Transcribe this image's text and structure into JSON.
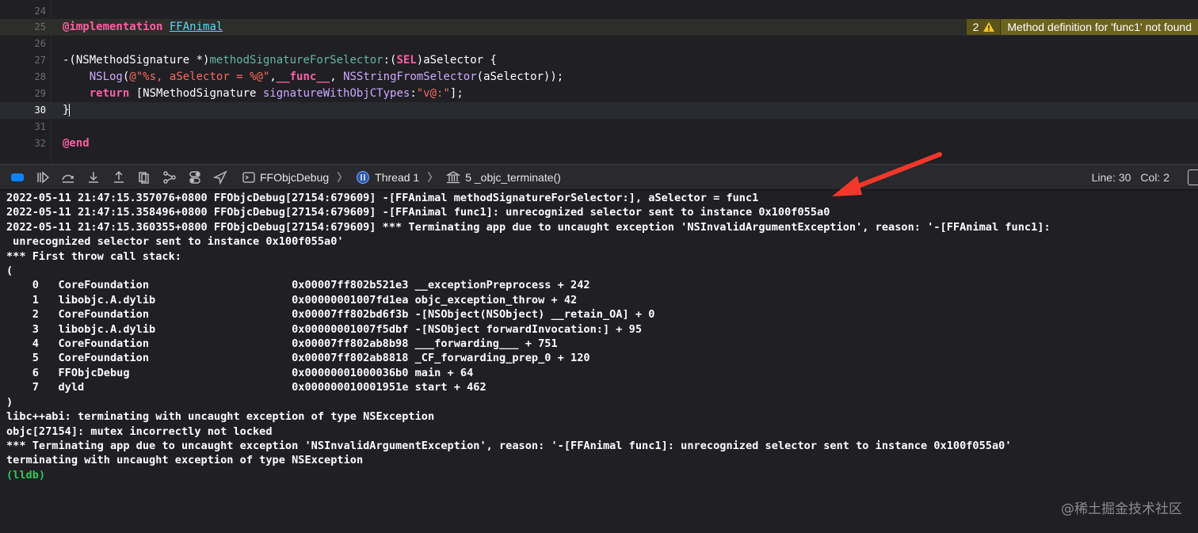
{
  "editor": {
    "lines": [
      {
        "num": "24",
        "segments": []
      },
      {
        "num": "25",
        "segments": [
          {
            "t": "@implementation",
            "c": "kw"
          },
          {
            "t": " ",
            "c": "plain"
          },
          {
            "t": "FFAnimal",
            "c": "cls"
          }
        ]
      },
      {
        "num": "26",
        "segments": []
      },
      {
        "num": "27",
        "segments": [
          {
            "t": "-(",
            "c": "plain"
          },
          {
            "t": "NSMethodSignature",
            "c": "plain"
          },
          {
            "t": " *)",
            "c": "plain"
          },
          {
            "t": "methodSignatureForSelector",
            "c": "fn"
          },
          {
            "t": ":(",
            "c": "plain"
          },
          {
            "t": "SEL",
            "c": "kw"
          },
          {
            "t": ")aSelector {",
            "c": "plain"
          }
        ]
      },
      {
        "num": "28",
        "segments": [
          {
            "t": "    ",
            "c": "plain"
          },
          {
            "t": "NSLog",
            "c": "nstype"
          },
          {
            "t": "(",
            "c": "plain"
          },
          {
            "t": "@\"%s, aSelector = %@\"",
            "c": "str"
          },
          {
            "t": ",",
            "c": "plain"
          },
          {
            "t": "__func__",
            "c": "kw"
          },
          {
            "t": ", ",
            "c": "plain"
          },
          {
            "t": "NSStringFromSelector",
            "c": "nstype"
          },
          {
            "t": "(aSelector));",
            "c": "plain"
          }
        ]
      },
      {
        "num": "29",
        "segments": [
          {
            "t": "    ",
            "c": "plain"
          },
          {
            "t": "return",
            "c": "kw"
          },
          {
            "t": " [NSMethodSignature ",
            "c": "plain"
          },
          {
            "t": "signatureWithObjCTypes",
            "c": "nstype"
          },
          {
            "t": ":",
            "c": "plain"
          },
          {
            "t": "\"v@:\"",
            "c": "str"
          },
          {
            "t": "];",
            "c": "plain"
          }
        ]
      },
      {
        "num": "30",
        "segments": [
          {
            "t": "}",
            "c": "plain"
          }
        ]
      },
      {
        "num": "31",
        "segments": []
      },
      {
        "num": "32",
        "segments": [
          {
            "t": "@end",
            "c": "kw"
          }
        ]
      }
    ],
    "issue": {
      "count": "2",
      "icon": "warning-icon",
      "message": "Method definition for 'func1' not found"
    }
  },
  "toolbar": {
    "target": "FFObjcDebug",
    "thread": "Thread 1",
    "frame": "5 _objc_terminate()",
    "line_status": "Line: 30",
    "col_status": "Col: 2"
  },
  "console": {
    "lines": [
      "2022-05-11 21:47:15.357076+0800 FFObjcDebug[27154:679609] -[FFAnimal methodSignatureForSelector:], aSelector = func1",
      "2022-05-11 21:47:15.358496+0800 FFObjcDebug[27154:679609] -[FFAnimal func1]: unrecognized selector sent to instance 0x100f055a0",
      "2022-05-11 21:47:15.360355+0800 FFObjcDebug[27154:679609] *** Terminating app due to uncaught exception 'NSInvalidArgumentException', reason: '-[FFAnimal func1]:",
      " unrecognized selector sent to instance 0x100f055a0'",
      "*** First throw call stack:",
      "(",
      "\t0   CoreFoundation                      0x00007ff802b521e3 __exceptionPreprocess + 242",
      "\t1   libobjc.A.dylib                     0x00000001007fd1ea objc_exception_throw + 42",
      "\t2   CoreFoundation                      0x00007ff802bd6f3b -[NSObject(NSObject) __retain_OA] + 0",
      "\t3   libobjc.A.dylib                     0x00000001007f5dbf -[NSObject forwardInvocation:] + 95",
      "\t4   CoreFoundation                      0x00007ff802ab8b98 ___forwarding___ + 751",
      "\t5   CoreFoundation                      0x00007ff802ab8818 _CF_forwarding_prep_0 + 120",
      "\t6   FFObjcDebug                         0x00000001000036b0 main + 64",
      "\t7   dyld                                0x000000010001951e start + 462",
      ")",
      "libc++abi: terminating with uncaught exception of type NSException",
      "objc[27154]: mutex incorrectly not locked",
      "*** Terminating app due to uncaught exception 'NSInvalidArgumentException', reason: '-[FFAnimal func1]: unrecognized selector sent to instance 0x100f055a0'",
      "terminating with uncaught exception of type NSException"
    ],
    "prompt": "(lldb)"
  },
  "watermark": "@稀土掘金技术社区",
  "colors": {
    "accent_arrow": "#f4372b",
    "issue_bg": "#6d6321",
    "lldb_prompt": "#33c758"
  }
}
